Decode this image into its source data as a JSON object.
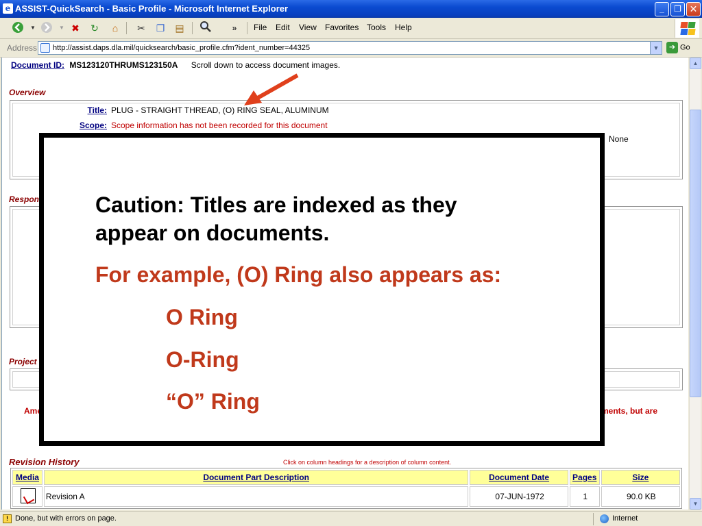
{
  "window": {
    "title": "ASSIST-QuickSearch - Basic Profile - Microsoft Internet Explorer",
    "minimize": "_",
    "maximize": "❐",
    "close": "✕"
  },
  "toolbar": {
    "more": "»",
    "menus": [
      "File",
      "Edit",
      "View",
      "Favorites",
      "Tools",
      "Help"
    ]
  },
  "address": {
    "label": "Address",
    "url": "http://assist.daps.dla.mil/quicksearch/basic_profile.cfm?ident_number=44325",
    "go": "Go"
  },
  "document": {
    "id_label": "Document ID:",
    "id_value": "MS123120THRUMS123150A",
    "scroll_note": "Scroll down to access document images."
  },
  "overview": {
    "header": "Overview",
    "title_label": "Title:",
    "title_value": "PLUG - STRAIGHT THREAD, (O) RING SEAL, ALUMINUM",
    "scope_label": "Scope:",
    "scope_value": "Scope information has not been recorded for this document",
    "right_value": "None"
  },
  "sections": {
    "responsible": "Respon",
    "project": "Project"
  },
  "amend": {
    "left": "Ame",
    "right": "ments, but are"
  },
  "revision_history": {
    "header": "Revision History",
    "note": "Click on column headings for a description of column content.",
    "columns": [
      "Media",
      "Document Part Description",
      "Document Date",
      "Pages",
      "Size"
    ],
    "rows": [
      {
        "description": "Revision A",
        "date": "07-JUN-1972",
        "pages": "1",
        "size": "90.0 KB"
      }
    ]
  },
  "callout": {
    "line1": "Caution:  Titles are indexed as they",
    "line2": "appear on documents.",
    "line3": "For example, (O) Ring also appears as:",
    "variants": [
      "O Ring",
      "O-Ring",
      "“O” Ring"
    ],
    "text_color": "#000000",
    "accent_color": "#c0391b"
  },
  "status": {
    "message": "Done, but with errors on page.",
    "zone": "Internet"
  }
}
